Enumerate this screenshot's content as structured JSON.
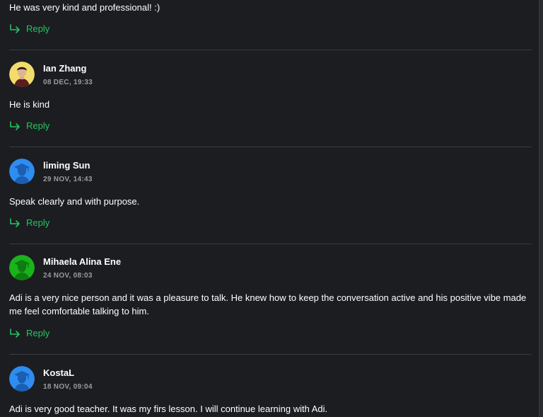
{
  "reply_label": "Reply",
  "colors": {
    "accent": "#22c55e",
    "background": "#1c1d21",
    "divider": "#3a3b40"
  },
  "first_review": {
    "text": "He was very kind and professional! :)"
  },
  "reviews": [
    {
      "name": "Ian Zhang",
      "date": "08 DEC, 19:33",
      "text": "He is kind",
      "avatar": "photo",
      "avatar_color": "#f2dc6b"
    },
    {
      "name": "liming Sun",
      "date": "29 NOV, 14:43",
      "text": "Speak clearly and with purpose.",
      "avatar": "graduation-cap-icon",
      "avatar_color": "#2f8cf0"
    },
    {
      "name": "Mihaela Alina Ene",
      "date": "24 NOV, 08:03",
      "text": "Adi is a very nice person and it was a pleasure to talk. He knew how to keep the conversation active and his positive vibe made me feel comfortable talking to him.",
      "avatar": "graduation-cap-icon",
      "avatar_color": "#19b31b"
    },
    {
      "name": "KostaL",
      "date": "18 NOV, 09:04",
      "text": "Adi is very good teacher. It was my firs lesson. I will continue learning with Adi.",
      "avatar": "graduation-cap-icon",
      "avatar_color": "#2f8cf0"
    }
  ]
}
